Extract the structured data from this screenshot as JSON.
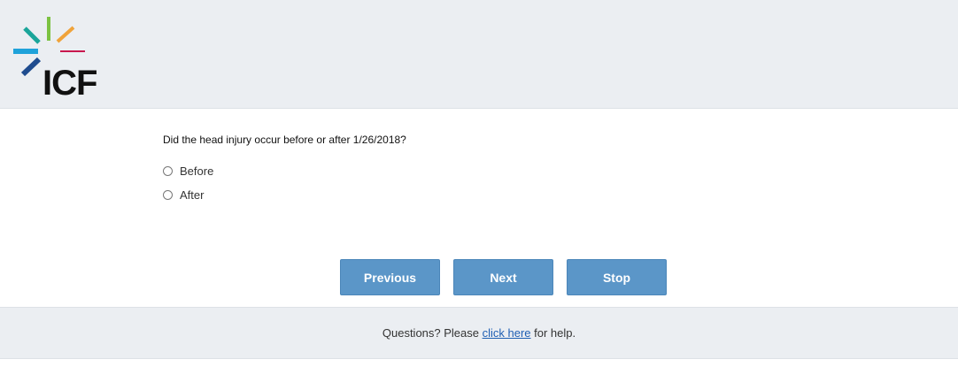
{
  "header": {
    "logo": {
      "text": "ICF",
      "icon": "icf-burst-logo"
    }
  },
  "survey": {
    "question": "Did the head injury occur before or after 1/26/2018?",
    "options": [
      "Before",
      "After"
    ]
  },
  "buttons": {
    "previous": "Previous",
    "next": "Next",
    "stop": "Stop"
  },
  "footer": {
    "prefix": "Questions? Please ",
    "link": "click here",
    "suffix": " for help."
  },
  "colors": {
    "button": "#5b96c8",
    "header_bg": "#ebeef2",
    "link": "#1f5fb3"
  }
}
